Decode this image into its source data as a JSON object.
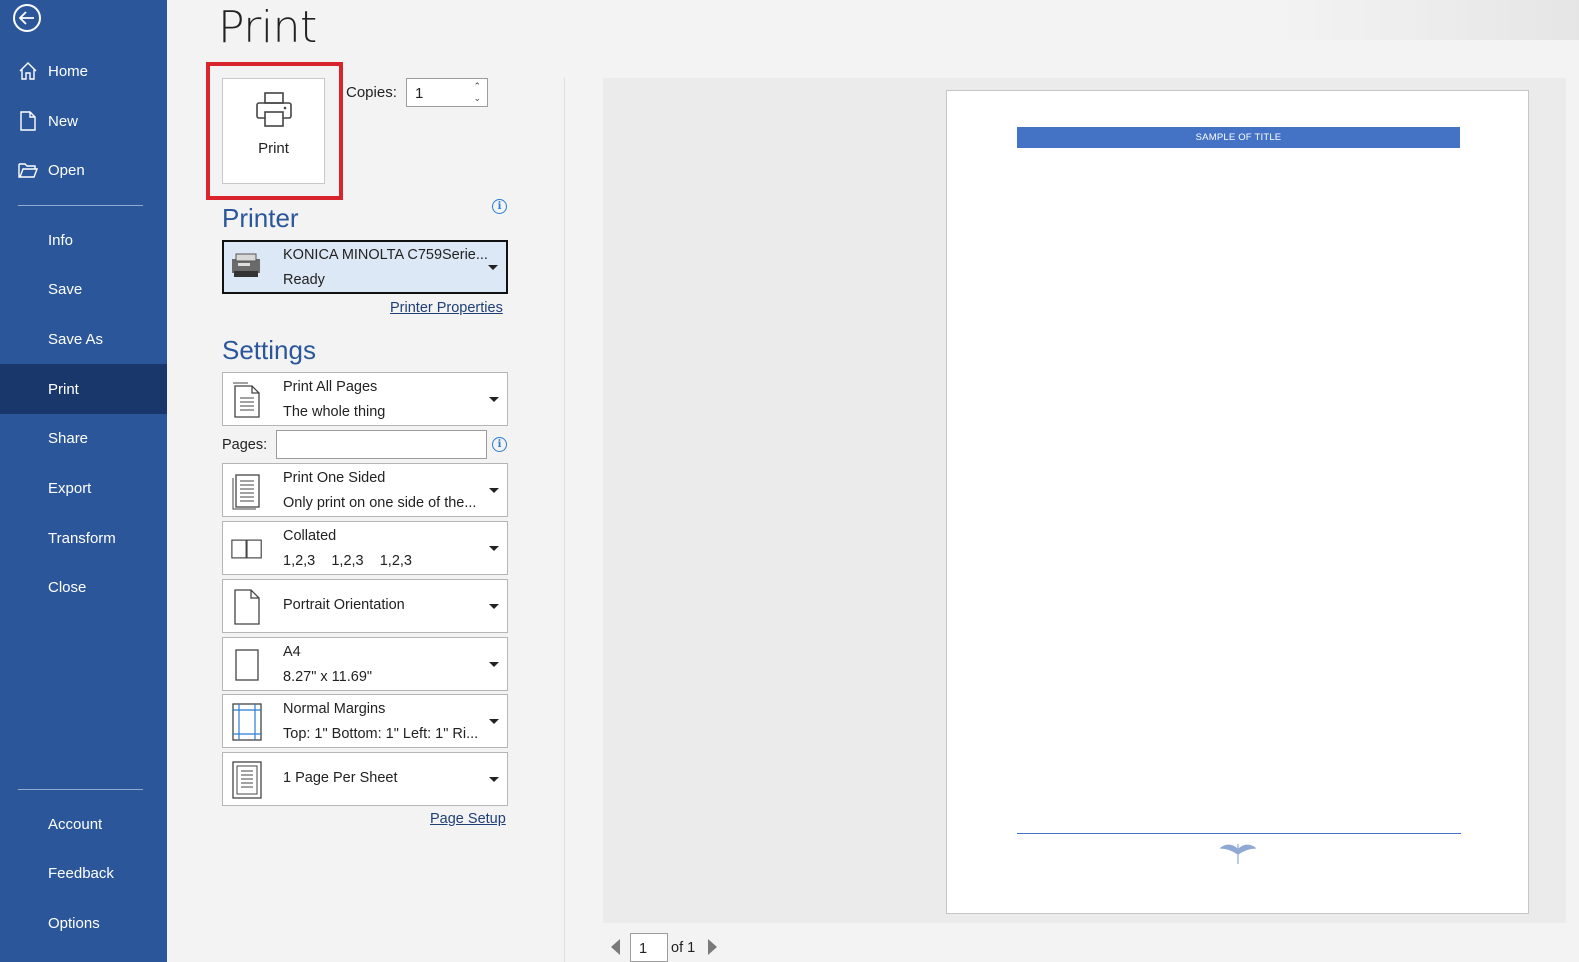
{
  "sidebar": {
    "items_top": [
      "Home",
      "New",
      "Open"
    ],
    "items_mid": [
      "Info",
      "Save",
      "Save As",
      "Print",
      "Share",
      "Export",
      "Transform",
      "Close"
    ],
    "items_bottom": [
      "Account",
      "Feedback",
      "Options"
    ],
    "active": "Print"
  },
  "page": {
    "title": "Print"
  },
  "print_button": {
    "label": "Print"
  },
  "copies": {
    "label": "Copies:",
    "value": "1"
  },
  "printer": {
    "heading": "Printer",
    "name": "KONICA MINOLTA C759Serie...",
    "status": "Ready",
    "properties_link": "Printer Properties"
  },
  "settings": {
    "heading": "Settings",
    "range": {
      "line1": "Print All Pages",
      "line2": "The whole thing"
    },
    "pages_label": "Pages:",
    "pages_value": "",
    "sides": {
      "line1": "Print One Sided",
      "line2": "Only print on one side of the..."
    },
    "collate": {
      "line1": "Collated",
      "line2": "1,2,3    1,2,3    1,2,3"
    },
    "orientation": {
      "line1": "Portrait Orientation"
    },
    "paper": {
      "line1": "A4",
      "line2": "8.27\" x 11.69\""
    },
    "margins": {
      "line1": "Normal Margins",
      "line2": "Top: 1\" Bottom: 1\" Left: 1\" Ri..."
    },
    "per_sheet": {
      "line1": "1 Page Per Sheet"
    },
    "page_setup_link": "Page Setup"
  },
  "preview": {
    "doc_title": "SAMPLE OF TITLE",
    "current_page": "1",
    "of_text": "of 1"
  },
  "colors": {
    "sidebar": "#2b579a",
    "sidebar_active": "#19376b",
    "highlight_border": "#d9232d",
    "accent": "#4472c4"
  }
}
